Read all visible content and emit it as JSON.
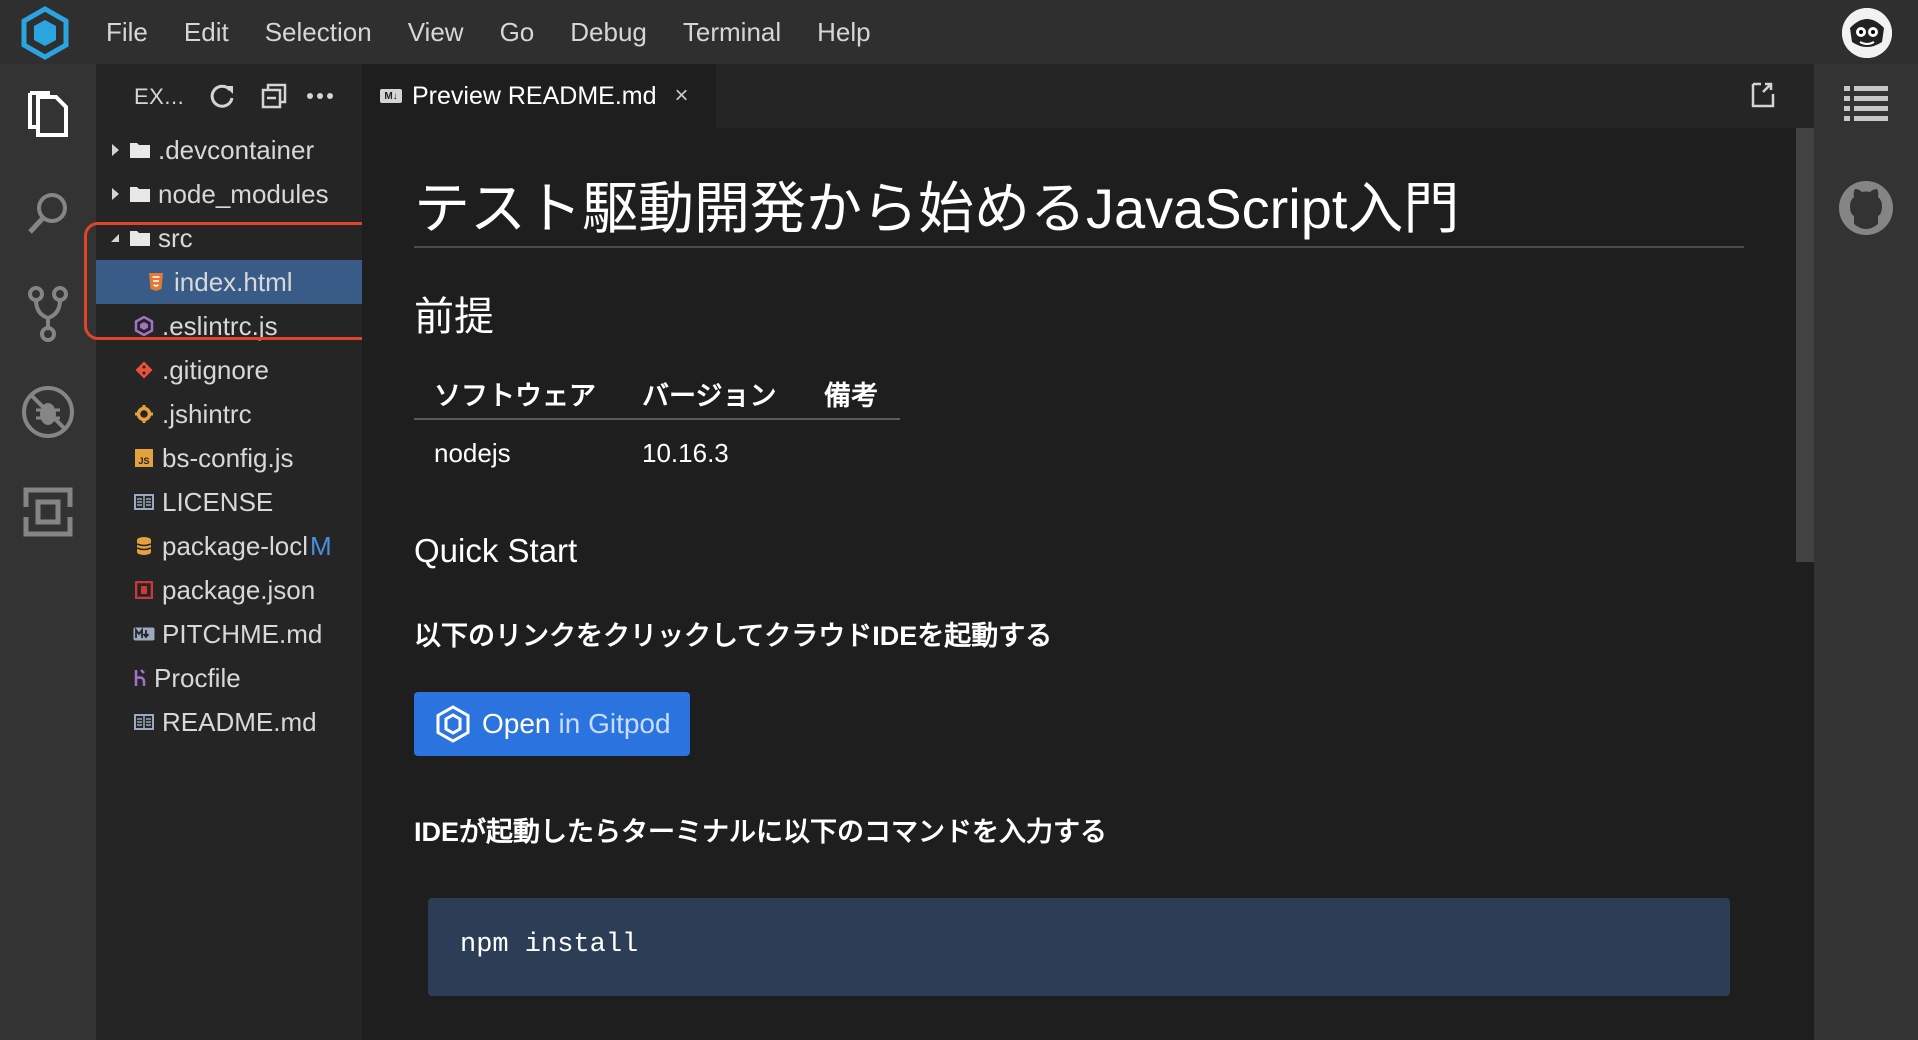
{
  "menubar": {
    "items": [
      "File",
      "Edit",
      "Selection",
      "View",
      "Go",
      "Debug",
      "Terminal",
      "Help"
    ]
  },
  "activitybar": {
    "icons": [
      "files-icon",
      "search-icon",
      "source-control-icon",
      "debug-icon",
      "extensions-icon"
    ]
  },
  "sidebar": {
    "title": "EX...",
    "tree": [
      {
        "label": ".devcontainer",
        "type": "folder",
        "expanded": false,
        "icon": "folder-icon"
      },
      {
        "label": "node_modules",
        "type": "folder",
        "expanded": false,
        "icon": "folder-icon"
      },
      {
        "label": "src",
        "type": "folder",
        "expanded": true,
        "icon": "folder-icon"
      },
      {
        "label": "index.html",
        "type": "file",
        "icon": "html-file-icon",
        "selected": true
      },
      {
        "label": ".eslintrc.js",
        "type": "file",
        "icon": "eslint-file-icon"
      },
      {
        "label": ".gitignore",
        "type": "file",
        "icon": "git-file-icon"
      },
      {
        "label": ".jshintrc",
        "type": "file",
        "icon": "config-file-icon"
      },
      {
        "label": "bs-config.js",
        "type": "file",
        "icon": "js-file-icon"
      },
      {
        "label": "LICENSE",
        "type": "file",
        "icon": "license-file-icon"
      },
      {
        "label": "package-locl",
        "type": "file",
        "icon": "package-lock-file-icon",
        "badge": "M"
      },
      {
        "label": "package.json",
        "type": "file",
        "icon": "npm-file-icon"
      },
      {
        "label": "PITCHME.md",
        "type": "file",
        "icon": "markdown-file-icon"
      },
      {
        "label": "Procfile",
        "type": "file",
        "icon": "procfile-icon"
      },
      {
        "label": "README.md",
        "type": "file",
        "icon": "readme-file-icon"
      }
    ]
  },
  "tab": {
    "label": "Preview README.md",
    "close": "×"
  },
  "preview": {
    "h1": "テスト駆動開発から始めるJavaScript入門",
    "h2": "前提",
    "table": {
      "headers": [
        "ソフトウェア",
        "バージョン",
        "備考"
      ],
      "rows": [
        [
          "nodejs",
          "10.16.3",
          ""
        ]
      ]
    },
    "h3": "Quick Start",
    "p1": "以下のリンクをクリックしてクラウドIDEを起動する",
    "button": {
      "open": "Open",
      "rest": "in Gitpod"
    },
    "p2": "IDEが起動したらターミナルに以下のコマンドを入力する",
    "code": "npm install"
  },
  "rightbar": {
    "icons": [
      "outline-list-icon",
      "github-icon"
    ]
  },
  "colors": {
    "accent": "#2b74e0",
    "selection": "#385c87",
    "highlight": "#e0442c",
    "code_bg": "#2c3e55"
  }
}
